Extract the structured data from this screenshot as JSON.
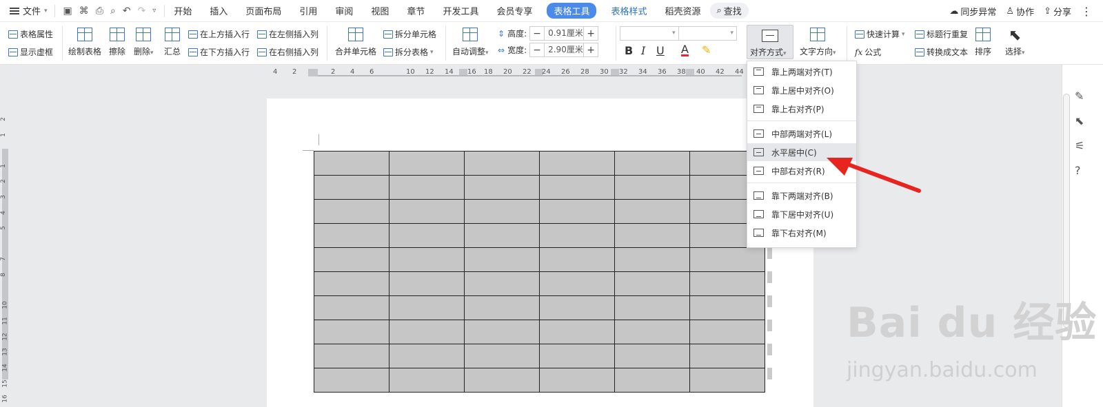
{
  "menubar": {
    "file": "文件",
    "tabs": [
      "开始",
      "插入",
      "页面布局",
      "引用",
      "审阅",
      "视图",
      "章节",
      "开发工具",
      "会员专享"
    ],
    "active_tab": "表格工具",
    "extra_tabs": [
      "表格样式",
      "稻壳资源"
    ],
    "search": "查找",
    "right": {
      "sync": "同步异常",
      "collab": "协作",
      "share": "分享"
    }
  },
  "ribbon": {
    "table_props": "表格属性",
    "show_gridlines": "显示虚框",
    "draw_table": "绘制表格",
    "erase": "擦除",
    "delete": "删除",
    "summary": "汇总",
    "insert_above": "在上方插入行",
    "insert_below": "在下方插入行",
    "insert_left": "在左侧插入列",
    "insert_right": "在右侧插入列",
    "merge_cells": "合并单元格",
    "split_cells": "拆分单元格",
    "split_table": "拆分表格",
    "auto_fit": "自动调整",
    "height_label": "高度:",
    "height_value": "0.91厘米",
    "width_label": "宽度:",
    "width_value": "2.90厘米",
    "align_label": "对齐方式",
    "text_dir": "文字方向",
    "quick_calc": "快速计算",
    "formula": "公式",
    "repeat_header": "标题行重复",
    "convert_text": "转换成文本",
    "sort": "排序",
    "select": "选择"
  },
  "ruler": {
    "h": [
      "4",
      "2",
      "2",
      "4",
      "6",
      "10",
      "12",
      "14",
      "16",
      "18",
      "20",
      "22",
      "24",
      "26",
      "28",
      "30",
      "32",
      "34",
      "36",
      "38",
      "40",
      "42",
      "44"
    ],
    "v": [
      "2",
      "1",
      "1",
      "2",
      "3",
      "4",
      "5",
      "7",
      "8",
      "10",
      "11",
      "12",
      "13",
      "14",
      "15",
      "16"
    ]
  },
  "dropdown": {
    "items": [
      "靠上两端对齐(T)",
      "靠上居中对齐(O)",
      "靠上右对齐(P)",
      "中部两端对齐(L)",
      "水平居中(C)",
      "中部右对齐(R)",
      "靠下两端对齐(B)",
      "靠下居中对齐(U)",
      "靠下右对齐(M)"
    ],
    "highlighted_index": 4
  },
  "watermark": {
    "main": "Bai du 经验",
    "sub": "jingyan.baidu.com"
  },
  "colors": {
    "accent": "#4a8ae8",
    "arrow": "#e8241e",
    "cell": "#c6c6c6"
  }
}
